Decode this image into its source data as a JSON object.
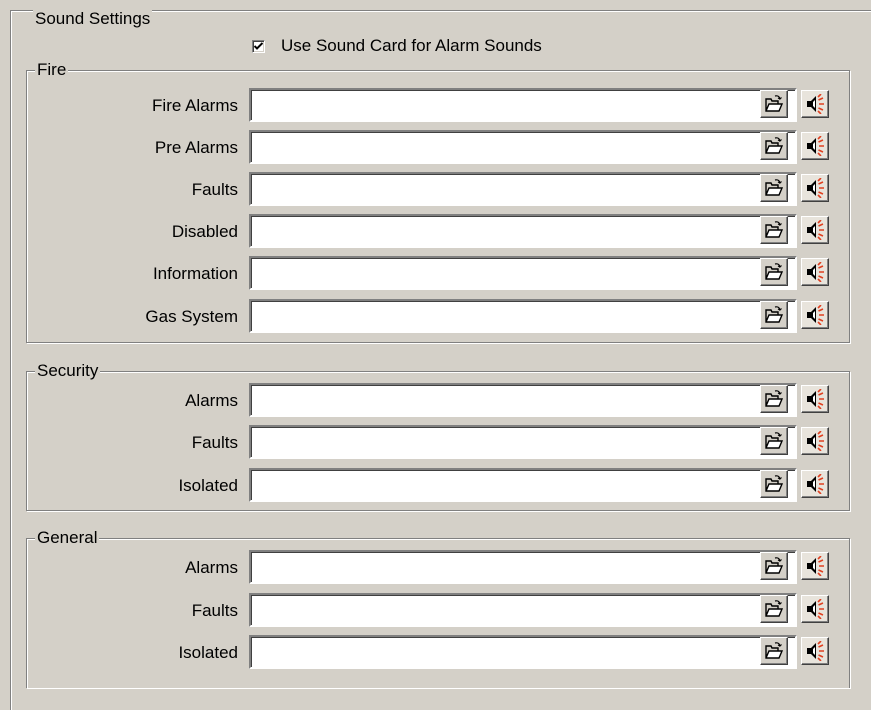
{
  "sound_settings": {
    "title": "Sound Settings",
    "use_sound_card": {
      "label": "Use Sound Card for Alarm Sounds",
      "checked": true
    }
  },
  "groups": {
    "fire": {
      "title": "Fire",
      "rows": [
        {
          "label": "Fire Alarms",
          "value": ""
        },
        {
          "label": "Pre Alarms",
          "value": ""
        },
        {
          "label": "Faults",
          "value": ""
        },
        {
          "label": "Disabled",
          "value": ""
        },
        {
          "label": "Information",
          "value": ""
        },
        {
          "label": "Gas System",
          "value": ""
        }
      ]
    },
    "security": {
      "title": "Security",
      "rows": [
        {
          "label": "Alarms",
          "value": ""
        },
        {
          "label": "Faults",
          "value": ""
        },
        {
          "label": "Isolated",
          "value": ""
        }
      ]
    },
    "general": {
      "title": "General",
      "rows": [
        {
          "label": "Alarms",
          "value": ""
        },
        {
          "label": "Faults",
          "value": ""
        },
        {
          "label": "Isolated",
          "value": ""
        }
      ]
    }
  },
  "icons": {
    "browse": "open-folder-icon",
    "play": "speaker-icon"
  },
  "colors": {
    "background": "#d4d0c8",
    "speaker_waves": "#e04020"
  }
}
